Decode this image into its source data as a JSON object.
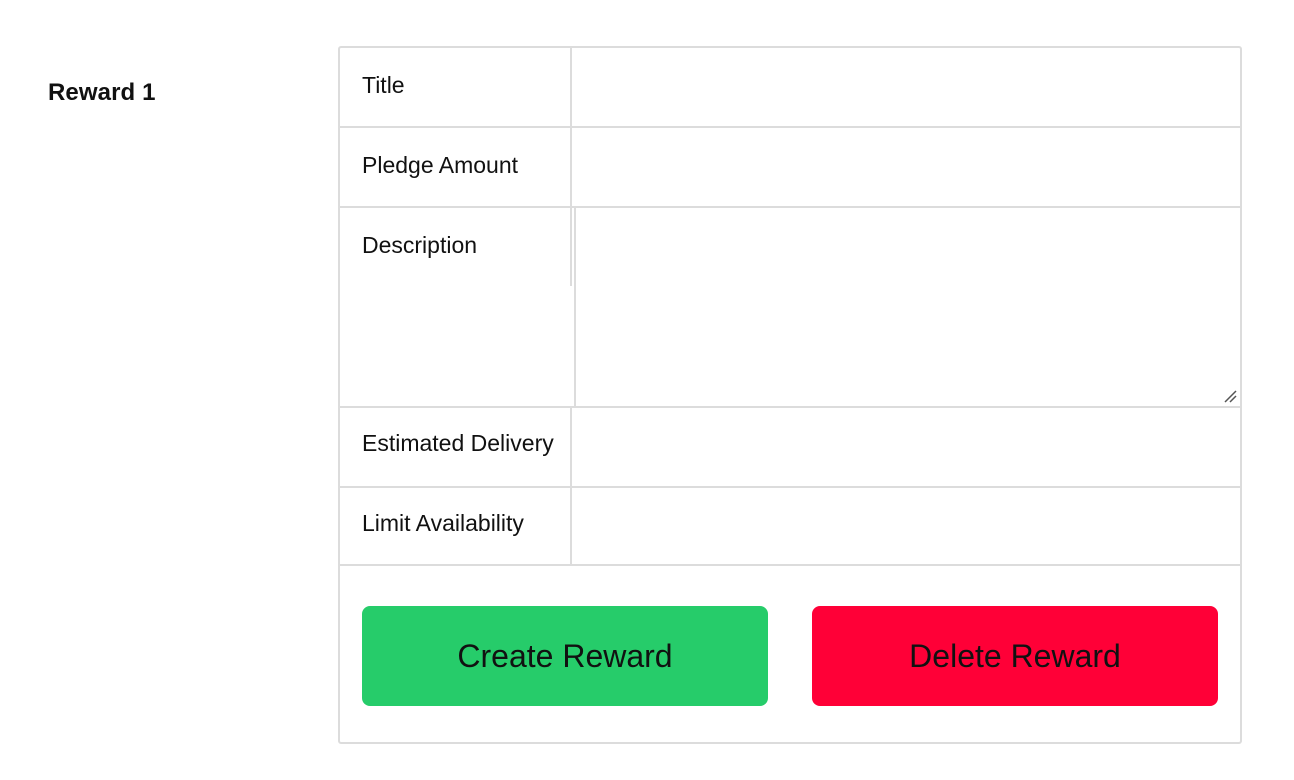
{
  "reward": {
    "heading": "Reward 1",
    "fields": [
      {
        "label": "Title",
        "value": ""
      },
      {
        "label": "Pledge Amount",
        "value": ""
      },
      {
        "label": "Description",
        "value": ""
      },
      {
        "label": "Estimated Delivery",
        "value": ""
      },
      {
        "label": "Limit Availability",
        "value": ""
      }
    ],
    "actions": {
      "create_label": "Create Reward",
      "delete_label": "Delete Reward"
    }
  },
  "colors": {
    "create_button": "#26cc6a",
    "delete_button": "#ff0037",
    "border": "#dcdcdc"
  },
  "icons": {
    "textarea_resize": "resize-grip-icon"
  }
}
